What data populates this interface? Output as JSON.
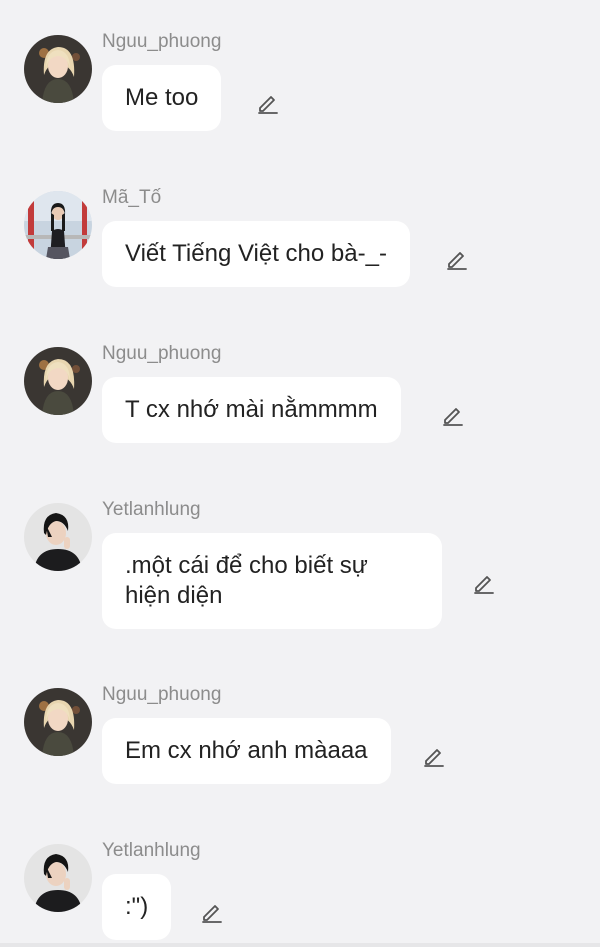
{
  "colors": {
    "background": "#f2f2f4",
    "bubble": "#ffffff",
    "username": "#8c8c8c",
    "text": "#222222",
    "icon": "#555555"
  },
  "messages": [
    {
      "username": "Nguu_phuong",
      "text": "Me too",
      "avatar": "girl-blonde-avatar",
      "icon": "edit-icon"
    },
    {
      "username": "Mã_Tố",
      "text": "Viết Tiếng Việt cho bà-_-",
      "avatar": "girl-outdoor-avatar",
      "icon": "edit-icon"
    },
    {
      "username": "Nguu_phuong",
      "text": "T cx nhớ mài nằmmmm",
      "avatar": "girl-blonde-avatar",
      "icon": "edit-icon"
    },
    {
      "username": "Yetlanhlung",
      "text": ".một cái để cho biết sự hiện diện",
      "avatar": "boy-dark-avatar",
      "icon": "edit-icon"
    },
    {
      "username": "Nguu_phuong",
      "text": "Em cx nhớ anh màaaa",
      "avatar": "girl-blonde-avatar",
      "icon": "edit-icon"
    },
    {
      "username": "Yetlanhlung",
      "text": ":\")",
      "avatar": "boy-dark-avatar",
      "icon": "edit-icon"
    }
  ]
}
